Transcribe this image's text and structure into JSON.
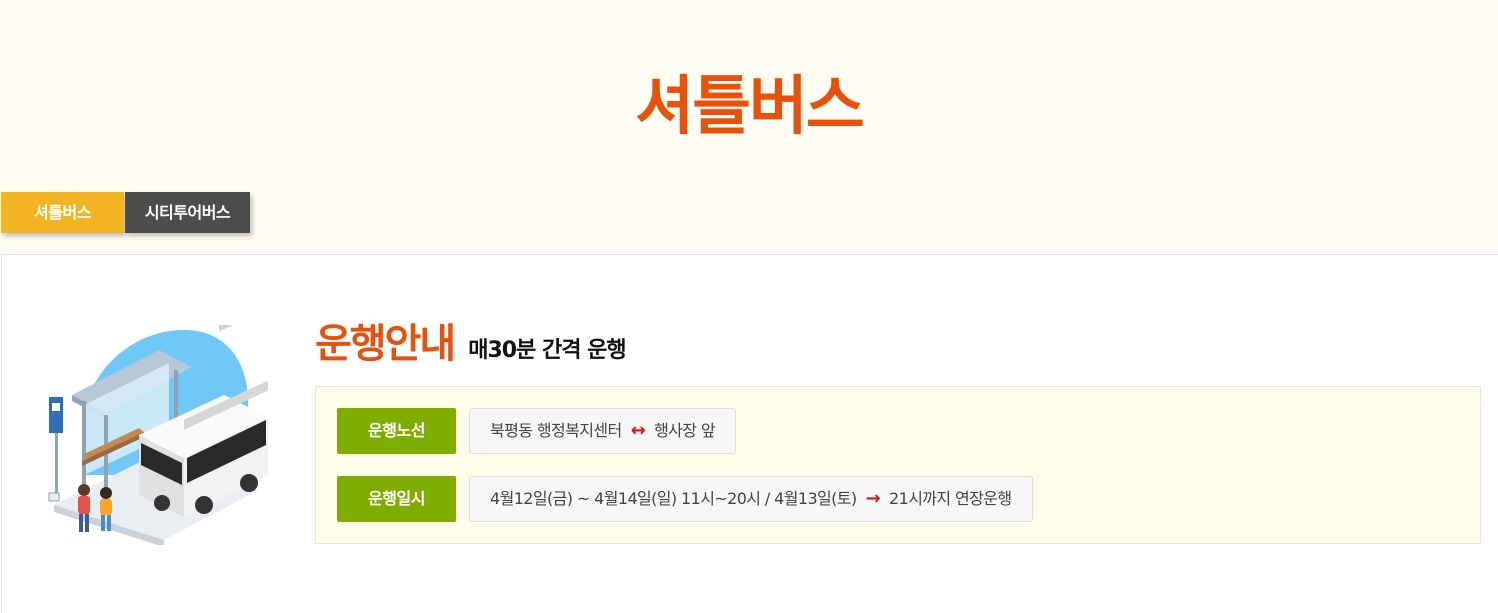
{
  "page": {
    "title": "셔틀버스"
  },
  "tabs": [
    {
      "label": "셔틀버스",
      "active": true
    },
    {
      "label": "시티투어버스",
      "active": false
    }
  ],
  "section": {
    "heading": "운행안내",
    "subheading": "매30분 간격 운행"
  },
  "info": {
    "route": {
      "label": "운행노선",
      "from": "북평동 행정복지센터",
      "arrow": "↔",
      "to": "행사장 앞"
    },
    "schedule": {
      "label": "운행일시",
      "text": "4월12일(금) ~ 4월14일(일) 11시~20시 / 4월13일(토)",
      "arrow": "→",
      "extended": "21시까지 연장운행"
    }
  },
  "colors": {
    "accent": "#e8510b",
    "tab_active": "#f2b422",
    "tab_inactive": "#4d4d4d",
    "label_green": "#7ead00",
    "arrow_red": "#e01010"
  },
  "icons": [
    "bus-stop-illustration"
  ]
}
